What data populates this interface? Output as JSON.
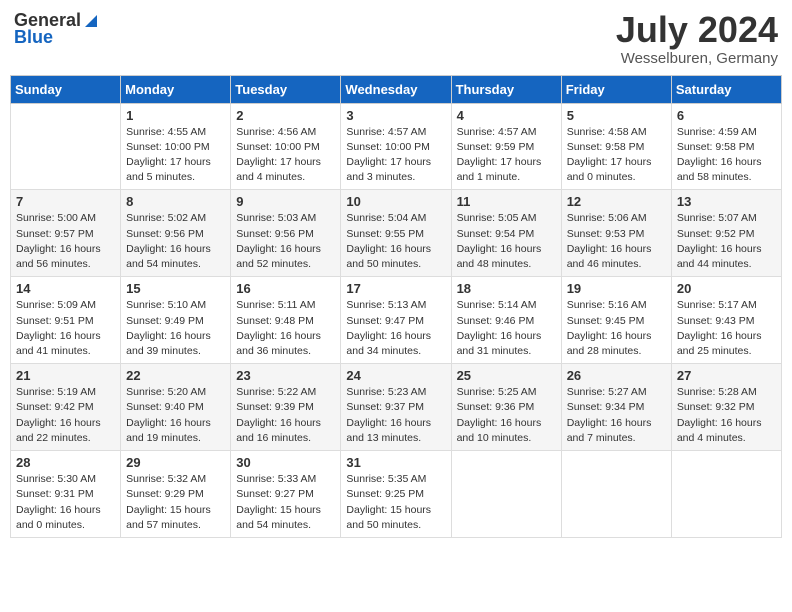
{
  "header": {
    "logo_general": "General",
    "logo_blue": "Blue",
    "month_year": "July 2024",
    "location": "Wesselburen, Germany"
  },
  "days_of_week": [
    "Sunday",
    "Monday",
    "Tuesday",
    "Wednesday",
    "Thursday",
    "Friday",
    "Saturday"
  ],
  "weeks": [
    [
      {
        "day": "",
        "info": ""
      },
      {
        "day": "1",
        "info": "Sunrise: 4:55 AM\nSunset: 10:00 PM\nDaylight: 17 hours\nand 5 minutes."
      },
      {
        "day": "2",
        "info": "Sunrise: 4:56 AM\nSunset: 10:00 PM\nDaylight: 17 hours\nand 4 minutes."
      },
      {
        "day": "3",
        "info": "Sunrise: 4:57 AM\nSunset: 10:00 PM\nDaylight: 17 hours\nand 3 minutes."
      },
      {
        "day": "4",
        "info": "Sunrise: 4:57 AM\nSunset: 9:59 PM\nDaylight: 17 hours\nand 1 minute."
      },
      {
        "day": "5",
        "info": "Sunrise: 4:58 AM\nSunset: 9:58 PM\nDaylight: 17 hours\nand 0 minutes."
      },
      {
        "day": "6",
        "info": "Sunrise: 4:59 AM\nSunset: 9:58 PM\nDaylight: 16 hours\nand 58 minutes."
      }
    ],
    [
      {
        "day": "7",
        "info": "Sunrise: 5:00 AM\nSunset: 9:57 PM\nDaylight: 16 hours\nand 56 minutes."
      },
      {
        "day": "8",
        "info": "Sunrise: 5:02 AM\nSunset: 9:56 PM\nDaylight: 16 hours\nand 54 minutes."
      },
      {
        "day": "9",
        "info": "Sunrise: 5:03 AM\nSunset: 9:56 PM\nDaylight: 16 hours\nand 52 minutes."
      },
      {
        "day": "10",
        "info": "Sunrise: 5:04 AM\nSunset: 9:55 PM\nDaylight: 16 hours\nand 50 minutes."
      },
      {
        "day": "11",
        "info": "Sunrise: 5:05 AM\nSunset: 9:54 PM\nDaylight: 16 hours\nand 48 minutes."
      },
      {
        "day": "12",
        "info": "Sunrise: 5:06 AM\nSunset: 9:53 PM\nDaylight: 16 hours\nand 46 minutes."
      },
      {
        "day": "13",
        "info": "Sunrise: 5:07 AM\nSunset: 9:52 PM\nDaylight: 16 hours\nand 44 minutes."
      }
    ],
    [
      {
        "day": "14",
        "info": "Sunrise: 5:09 AM\nSunset: 9:51 PM\nDaylight: 16 hours\nand 41 minutes."
      },
      {
        "day": "15",
        "info": "Sunrise: 5:10 AM\nSunset: 9:49 PM\nDaylight: 16 hours\nand 39 minutes."
      },
      {
        "day": "16",
        "info": "Sunrise: 5:11 AM\nSunset: 9:48 PM\nDaylight: 16 hours\nand 36 minutes."
      },
      {
        "day": "17",
        "info": "Sunrise: 5:13 AM\nSunset: 9:47 PM\nDaylight: 16 hours\nand 34 minutes."
      },
      {
        "day": "18",
        "info": "Sunrise: 5:14 AM\nSunset: 9:46 PM\nDaylight: 16 hours\nand 31 minutes."
      },
      {
        "day": "19",
        "info": "Sunrise: 5:16 AM\nSunset: 9:45 PM\nDaylight: 16 hours\nand 28 minutes."
      },
      {
        "day": "20",
        "info": "Sunrise: 5:17 AM\nSunset: 9:43 PM\nDaylight: 16 hours\nand 25 minutes."
      }
    ],
    [
      {
        "day": "21",
        "info": "Sunrise: 5:19 AM\nSunset: 9:42 PM\nDaylight: 16 hours\nand 22 minutes."
      },
      {
        "day": "22",
        "info": "Sunrise: 5:20 AM\nSunset: 9:40 PM\nDaylight: 16 hours\nand 19 minutes."
      },
      {
        "day": "23",
        "info": "Sunrise: 5:22 AM\nSunset: 9:39 PM\nDaylight: 16 hours\nand 16 minutes."
      },
      {
        "day": "24",
        "info": "Sunrise: 5:23 AM\nSunset: 9:37 PM\nDaylight: 16 hours\nand 13 minutes."
      },
      {
        "day": "25",
        "info": "Sunrise: 5:25 AM\nSunset: 9:36 PM\nDaylight: 16 hours\nand 10 minutes."
      },
      {
        "day": "26",
        "info": "Sunrise: 5:27 AM\nSunset: 9:34 PM\nDaylight: 16 hours\nand 7 minutes."
      },
      {
        "day": "27",
        "info": "Sunrise: 5:28 AM\nSunset: 9:32 PM\nDaylight: 16 hours\nand 4 minutes."
      }
    ],
    [
      {
        "day": "28",
        "info": "Sunrise: 5:30 AM\nSunset: 9:31 PM\nDaylight: 16 hours\nand 0 minutes."
      },
      {
        "day": "29",
        "info": "Sunrise: 5:32 AM\nSunset: 9:29 PM\nDaylight: 15 hours\nand 57 minutes."
      },
      {
        "day": "30",
        "info": "Sunrise: 5:33 AM\nSunset: 9:27 PM\nDaylight: 15 hours\nand 54 minutes."
      },
      {
        "day": "31",
        "info": "Sunrise: 5:35 AM\nSunset: 9:25 PM\nDaylight: 15 hours\nand 50 minutes."
      },
      {
        "day": "",
        "info": ""
      },
      {
        "day": "",
        "info": ""
      },
      {
        "day": "",
        "info": ""
      }
    ]
  ]
}
